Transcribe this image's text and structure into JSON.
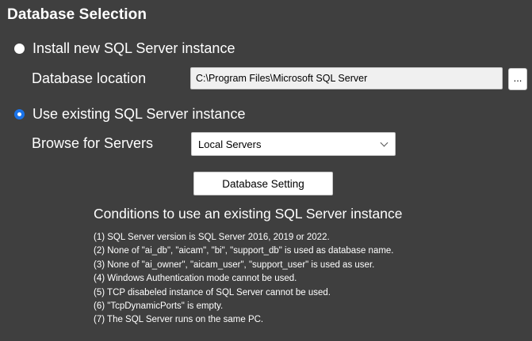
{
  "title": "Database Selection",
  "install_new": {
    "label": "Install new SQL Server instance",
    "checked": false,
    "location_label": "Database location",
    "location_value": "C:\\Program Files\\Microsoft SQL Server",
    "browse_label": "..."
  },
  "use_existing": {
    "label": "Use existing SQL Server instance",
    "checked": true,
    "browse_servers_label": "Browse for Servers",
    "selected_server": "Local Servers",
    "database_setting_label": "Database Setting"
  },
  "conditions": {
    "title": "Conditions to use an existing SQL Server instance",
    "items": [
      "(1) SQL Server version is SQL Server 2016, 2019 or 2022.",
      "(2) None of \"ai_db\", \"aicam\", \"bi\", \"support_db\" is used as database name.",
      "(3) None of \"ai_owner\", \"aicam_user\", \"support_user\" is used as user.",
      "(4) Windows Authentication mode cannot be used.",
      "(5) TCP disabeled instance of SQL Server cannot be used.",
      "(6) \"TcpDynamicPorts\" is empty.",
      "(7) The SQL Server runs on the same PC."
    ]
  },
  "colors": {
    "background": "#3f3f3f",
    "radio_selected": "#1a73e8"
  }
}
